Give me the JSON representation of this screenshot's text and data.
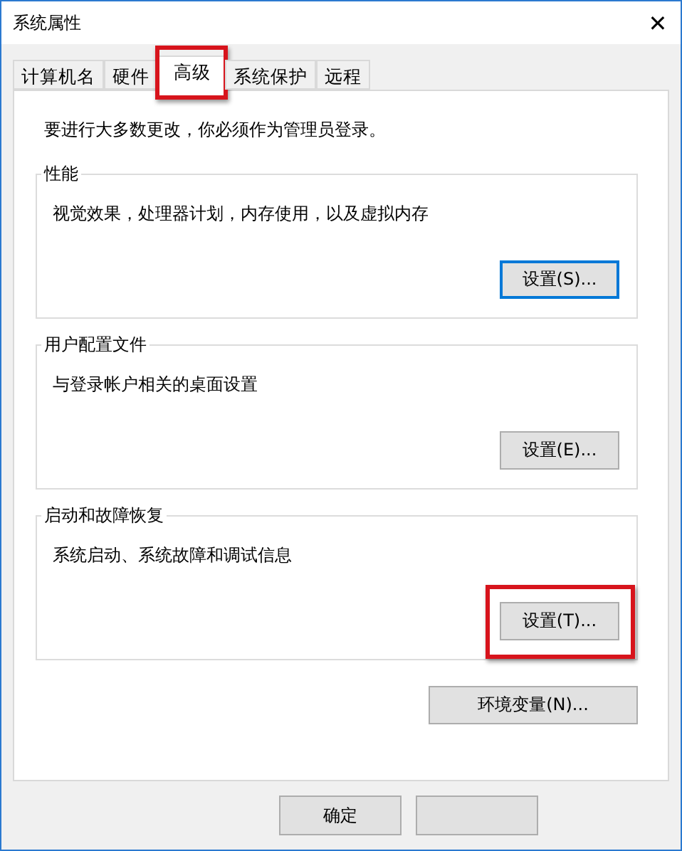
{
  "window": {
    "title": "系统属性",
    "close": "✕"
  },
  "tabs": [
    {
      "label": "计算机名",
      "selected": false,
      "highlighted": false
    },
    {
      "label": "硬件",
      "selected": false,
      "highlighted": false
    },
    {
      "label": "高级",
      "selected": true,
      "highlighted": true
    },
    {
      "label": "系统保护",
      "selected": false,
      "highlighted": false
    },
    {
      "label": "远程",
      "selected": false,
      "highlighted": false
    }
  ],
  "notice": "要进行大多数更改，你必须作为管理员登录。",
  "groups": [
    {
      "title": "性能",
      "description": "视觉效果，处理器计划，内存使用，以及虚拟内存",
      "button": {
        "label": "设置(S)...",
        "focused": true,
        "highlighted": false
      }
    },
    {
      "title": "用户配置文件",
      "description": "与登录帐户相关的桌面设置",
      "button": {
        "label": "设置(E)...",
        "focused": false,
        "highlighted": false
      }
    },
    {
      "title": "启动和故障恢复",
      "description": "系统启动、系统故障和调试信息",
      "button": {
        "label": "设置(T)...",
        "focused": false,
        "highlighted": true
      }
    }
  ],
  "env_button": {
    "label": "环境变量(N)..."
  },
  "buttons": [
    {
      "kind": "labeled",
      "label": "确定"
    },
    {
      "kind": "blank"
    }
  ]
}
